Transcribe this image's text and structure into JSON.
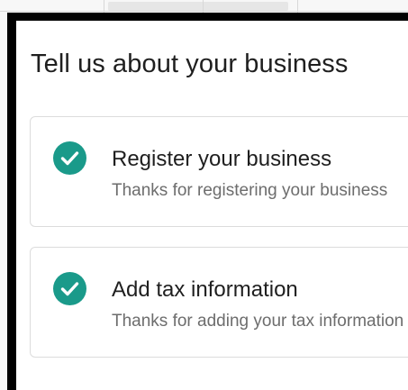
{
  "panel": {
    "title": "Tell us about your business"
  },
  "steps": [
    {
      "title": "Register your business",
      "subtitle": "Thanks for registering your business",
      "status": "completed",
      "icon": "check-circle-icon"
    },
    {
      "title": "Add tax information",
      "subtitle": "Thanks for adding your tax information",
      "status": "completed",
      "icon": "check-circle-icon"
    }
  ],
  "colors": {
    "accent": "#1a9a8a",
    "text": "#1f1f1f",
    "muted": "#6d6d6d",
    "border": "#dcdcdc",
    "frame": "#000000"
  }
}
